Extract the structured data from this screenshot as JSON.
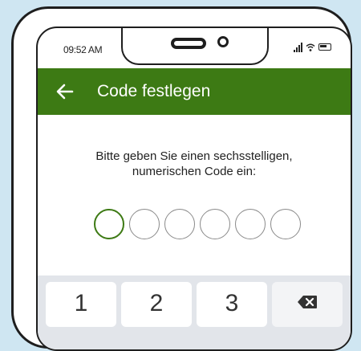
{
  "status_bar": {
    "time": "09:52 AM",
    "icons": [
      "signal-icon",
      "wifi-icon",
      "battery-icon"
    ]
  },
  "app_bar": {
    "back_icon": "arrow-left-icon",
    "title": "Code festlegen",
    "color": "#3d7a14"
  },
  "prompt": {
    "line1": "Bitte geben Sie einen sechsstelligen,",
    "line2": "numerischen Code ein:"
  },
  "pin": {
    "length": 6,
    "filled": 0,
    "active_index": 0
  },
  "keypad": {
    "keys": [
      "1",
      "2",
      "3"
    ],
    "delete_icon": "backspace-icon"
  }
}
